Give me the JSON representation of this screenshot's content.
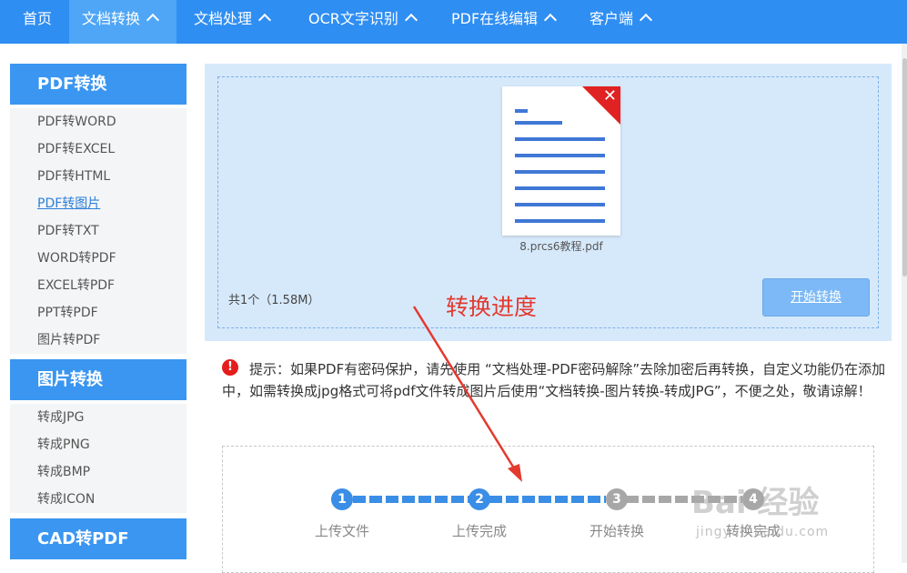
{
  "nav": {
    "items": [
      {
        "label": "首页",
        "active": false,
        "dropdown": false
      },
      {
        "label": "文档转换",
        "active": true,
        "dropdown": true
      },
      {
        "label": "文档处理",
        "active": false,
        "dropdown": true
      },
      {
        "label": "OCR文字识别",
        "active": false,
        "dropdown": true
      },
      {
        "label": "PDF在线编辑",
        "active": false,
        "dropdown": true
      },
      {
        "label": "客户端",
        "active": false,
        "dropdown": true
      }
    ]
  },
  "sidebar": {
    "sections": [
      {
        "title": "PDF转换",
        "items": [
          "PDF转WORD",
          "PDF转EXCEL",
          "PDF转HTML",
          "PDF转图片",
          "PDF转TXT",
          "WORD转PDF",
          "EXCEL转PDF",
          "PPT转PDF",
          "图片转PDF"
        ]
      },
      {
        "title": "图片转换",
        "items": [
          "转成JPG",
          "转成PNG",
          "转成BMP",
          "转成ICON"
        ]
      },
      {
        "title": "CAD转PDF",
        "items": []
      }
    ],
    "current_item": "PDF转图片"
  },
  "upload": {
    "file_name": "8.prcs6教程.pdf",
    "file_count": "共1个（1.58M）",
    "start_button": "开始转换",
    "remove_icon": "close-icon"
  },
  "annotation": {
    "label": "转换进度",
    "color": "#e33a2f"
  },
  "tip": {
    "icon_symbol": "!",
    "text": "提示：如果PDF有密码保护，请先使用 “文档处理-PDF密码解除”去除加密后再转换，自定义功能仍在添加中，如需转换成jpg格式可将pdf文件转成图片后使用“文档转换-图片转换-转成JPG”，不便之处，敬请谅解！"
  },
  "progress": {
    "steps": [
      {
        "number": "1",
        "label": "上传文件",
        "done": true
      },
      {
        "number": "2",
        "label": "上传完成",
        "done": true
      },
      {
        "number": "3",
        "label": "开始转换",
        "done": false
      },
      {
        "number": "4",
        "label": "转换完成",
        "done": false
      }
    ]
  },
  "watermark": {
    "brand": "Bai 经验",
    "url": "jingyan.baidu.com"
  },
  "colors": {
    "nav_bg": "#2f8ef2",
    "nav_active": "#4fa6f6",
    "accent": "#3a96f1",
    "done_step": "#3a8ee6",
    "todo_step": "#a7a7a7",
    "alert": "#e51d1d"
  }
}
